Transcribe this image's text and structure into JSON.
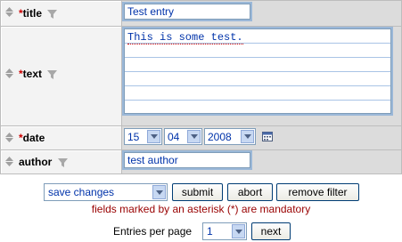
{
  "fields": [
    {
      "name": "title",
      "required": true,
      "value": "Test entry"
    },
    {
      "name": "text",
      "required": true,
      "value": "This is some test."
    },
    {
      "name": "date",
      "required": true,
      "day": "15",
      "month": "04",
      "year": "2008"
    },
    {
      "name": "author",
      "required": false,
      "value": "test author"
    }
  ],
  "required_marker": "*",
  "actions": {
    "mode_select": "save changes",
    "submit_label": "submit",
    "abort_label": "abort",
    "remove_filter_label": "remove filter"
  },
  "mandatory_note": "fields marked by an asterisk (*) are mandatory",
  "paging": {
    "entries_label": "Entries per page",
    "entries_value": "1",
    "next_label": "next"
  },
  "colors": {
    "required": "#cc0000",
    "input_text": "#0033aa",
    "note": "#990000"
  }
}
